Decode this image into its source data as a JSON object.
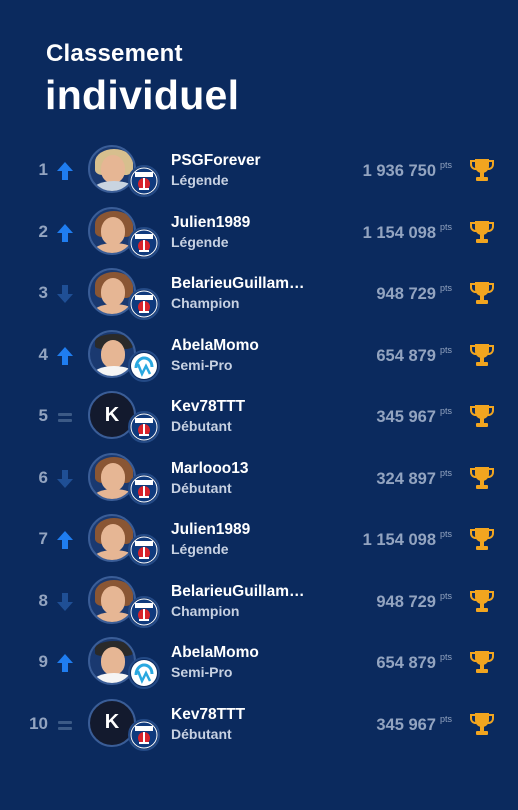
{
  "header": {
    "title_line1": "Classement",
    "title_line2": "individuel"
  },
  "colors": {
    "background": "#0b2a5e",
    "up_arrow": "#1f7df0",
    "down_arrow": "#1f4f95",
    "equal": "#3c5a86",
    "trophy": "#f2a51f",
    "muted": "#93a4c0"
  },
  "rows": [
    {
      "rank": "1",
      "trend": "up",
      "avatar": "blonde-woman",
      "club": "psg",
      "name": "PSGForever",
      "level": "Légende",
      "points": "1 936 750",
      "pts_label": "pts"
    },
    {
      "rank": "2",
      "trend": "up",
      "avatar": "brown-woman",
      "club": "psg",
      "name": "Julien1989",
      "level": "Légende",
      "points": "1 154 098",
      "pts_label": "pts"
    },
    {
      "rank": "3",
      "trend": "down",
      "avatar": "brown-woman",
      "club": "psg",
      "name": "BelarieuGuillam…",
      "level": "Champion",
      "points": "948 729",
      "pts_label": "pts"
    },
    {
      "rank": "4",
      "trend": "up",
      "avatar": "man-glasses",
      "club": "om",
      "name": "AbelaMomo",
      "level": "Semi-Pro",
      "points": "654 879",
      "pts_label": "pts"
    },
    {
      "rank": "5",
      "trend": "equal",
      "avatar": "letter",
      "letter": "K",
      "club": "psg",
      "name": "Kev78TTT",
      "level": "Débutant",
      "points": "345 967",
      "pts_label": "pts"
    },
    {
      "rank": "6",
      "trend": "down",
      "avatar": "brown-woman",
      "club": "psg",
      "name": "Marlooo13",
      "level": "Débutant",
      "points": "324 897",
      "pts_label": "pts"
    },
    {
      "rank": "7",
      "trend": "up",
      "avatar": "brown-woman",
      "club": "psg",
      "name": "Julien1989",
      "level": "Légende",
      "points": "1 154 098",
      "pts_label": "pts"
    },
    {
      "rank": "8",
      "trend": "down",
      "avatar": "brown-woman",
      "club": "psg",
      "name": "BelarieuGuillam…",
      "level": "Champion",
      "points": "948 729",
      "pts_label": "pts"
    },
    {
      "rank": "9",
      "trend": "up",
      "avatar": "man-glasses",
      "club": "om",
      "name": "AbelaMomo",
      "level": "Semi-Pro",
      "points": "654 879",
      "pts_label": "pts"
    },
    {
      "rank": "10",
      "trend": "equal",
      "avatar": "letter",
      "letter": "K",
      "club": "psg",
      "name": "Kev78TTT",
      "level": "Débutant",
      "points": "345 967",
      "pts_label": "pts"
    }
  ]
}
